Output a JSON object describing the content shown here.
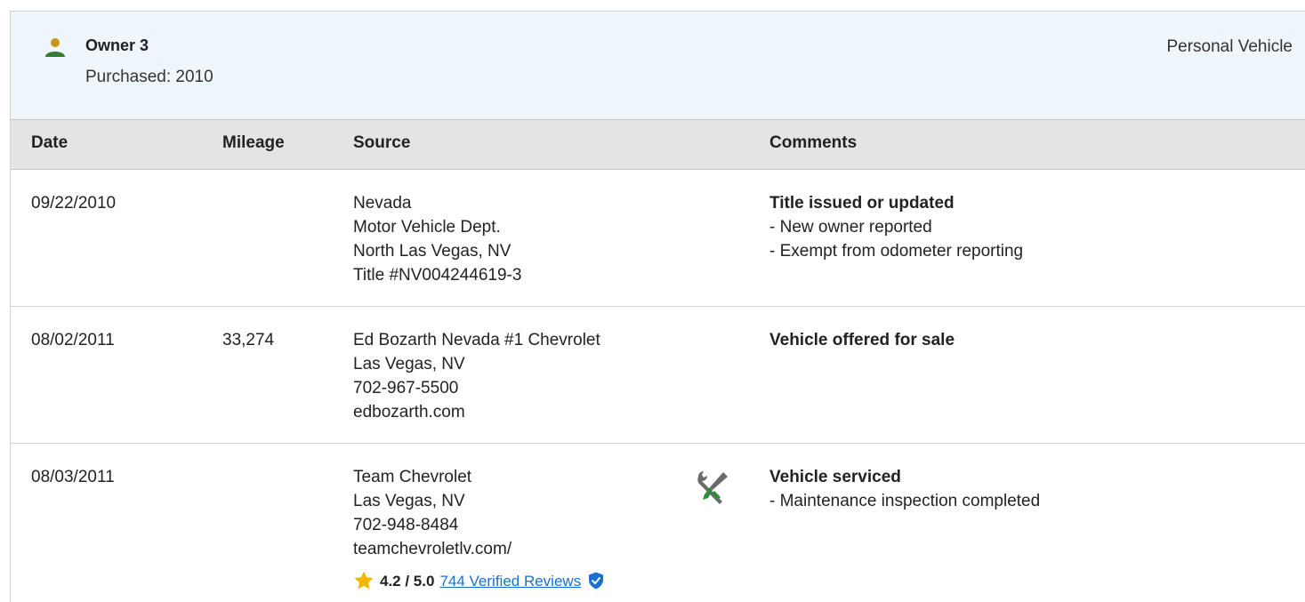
{
  "owner": {
    "name": "Owner 3",
    "purchased": "Purchased: 2010",
    "vehicle_type": "Personal Vehicle"
  },
  "table": {
    "headers": [
      "Date",
      "Mileage",
      "Source",
      "Comments"
    ],
    "rows": [
      {
        "date": "09/22/2010",
        "mileage": "",
        "source": [
          "Nevada",
          "Motor Vehicle Dept.",
          "North Las Vegas, NV",
          "Title #NV004244619-3"
        ],
        "comment_title": "Title issued or updated",
        "comment_lines": [
          "- New owner reported",
          "- Exempt from odometer reporting"
        ]
      },
      {
        "date": "08/02/2011",
        "mileage": "33,274",
        "source": [
          "Ed Bozarth Nevada #1 Chevrolet",
          "Las Vegas, NV",
          "702-967-5500",
          "edbozarth.com"
        ],
        "comment_title": "Vehicle offered for sale",
        "comment_lines": []
      },
      {
        "date": "08/03/2011",
        "mileage": "",
        "source": [
          "Team Chevrolet",
          "Las Vegas, NV",
          "702-948-8484",
          "teamchevroletlv.com/"
        ],
        "icon": "service-tools-icon",
        "comment_title": "Vehicle serviced",
        "comment_lines": [
          "- Maintenance inspection completed"
        ],
        "rating": {
          "score": "4.2 / 5.0",
          "reviews_link": "744 Verified Reviews"
        }
      }
    ]
  },
  "colors": {
    "header_bg": "#eef5fb",
    "table_header_bg": "#e4e4e4",
    "owner_icon_head": "#c8951b",
    "owner_icon_body": "#2e7d32",
    "link": "#1a6fd1",
    "star": "#f5b500",
    "tool_grey": "#6b6b6b",
    "tool_green": "#2e8b3e"
  }
}
